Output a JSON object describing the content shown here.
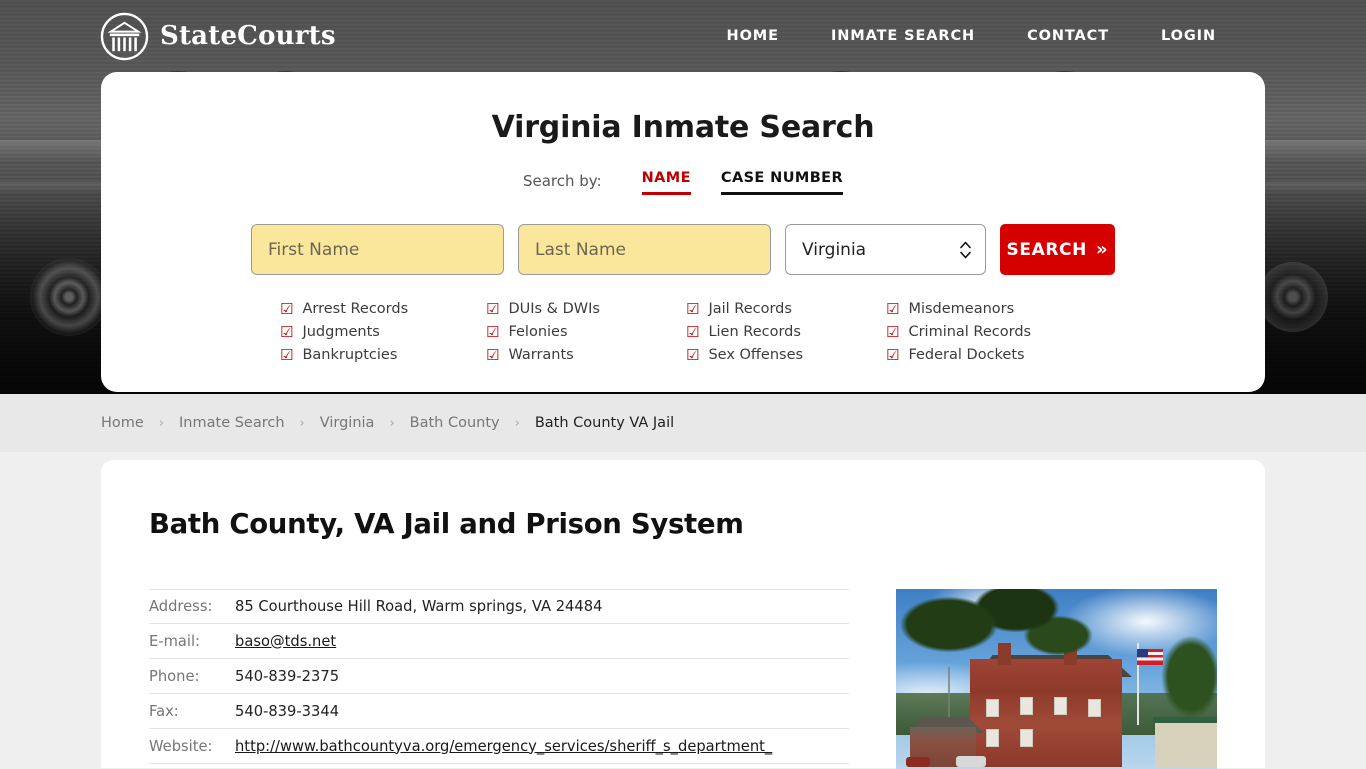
{
  "header": {
    "brand": "StateCourts",
    "logo_icon": "courthouse-circle-icon",
    "nav": [
      {
        "label": "HOME"
      },
      {
        "label": "INMATE SEARCH"
      },
      {
        "label": "CONTACT"
      },
      {
        "label": "LOGIN"
      }
    ]
  },
  "search_card": {
    "title": "Virginia Inmate Search",
    "search_by_label": "Search by:",
    "tabs": [
      {
        "label": "NAME",
        "active": true
      },
      {
        "label": "CASE NUMBER",
        "active": false
      }
    ],
    "first_name_placeholder": "First Name",
    "first_name_value": "",
    "last_name_placeholder": "Last Name",
    "last_name_value": "",
    "state_value": "Virginia",
    "search_button": "SEARCH",
    "search_button_chevron": "»",
    "checkbox_glyph": "☑",
    "record_types": [
      "Arrest Records",
      "DUIs & DWIs",
      "Jail Records",
      "Misdemeanors",
      "Judgments",
      "Felonies",
      "Lien Records",
      "Criminal Records",
      "Bankruptcies",
      "Warrants",
      "Sex Offenses",
      "Federal Dockets"
    ],
    "accent_color": "#c00000",
    "button_color": "#d50000",
    "input_fill": "#fbe79c"
  },
  "breadcrumb": {
    "separator": "›",
    "items": [
      {
        "label": "Home",
        "current": false
      },
      {
        "label": "Inmate Search",
        "current": false
      },
      {
        "label": "Virginia",
        "current": false
      },
      {
        "label": "Bath County",
        "current": false
      },
      {
        "label": "Bath County VA Jail",
        "current": true
      }
    ]
  },
  "content": {
    "page_title": "Bath County, VA Jail and Prison System",
    "info": [
      {
        "label": "Address:",
        "value": "85 Courthouse Hill Road, Warm springs, VA 24484",
        "link": false
      },
      {
        "label": "E-mail:",
        "value": "baso@tds.net",
        "link": true
      },
      {
        "label": "Phone:",
        "value": "540-839-2375",
        "link": false
      },
      {
        "label": "Fax:",
        "value": "540-839-3344",
        "link": false
      },
      {
        "label": "Website:",
        "value": "http://www.bathcountyva.org/emergency_services/sheriff_s_department_",
        "link": true
      }
    ],
    "photo_alt": "bath-county-courthouse-photo"
  }
}
